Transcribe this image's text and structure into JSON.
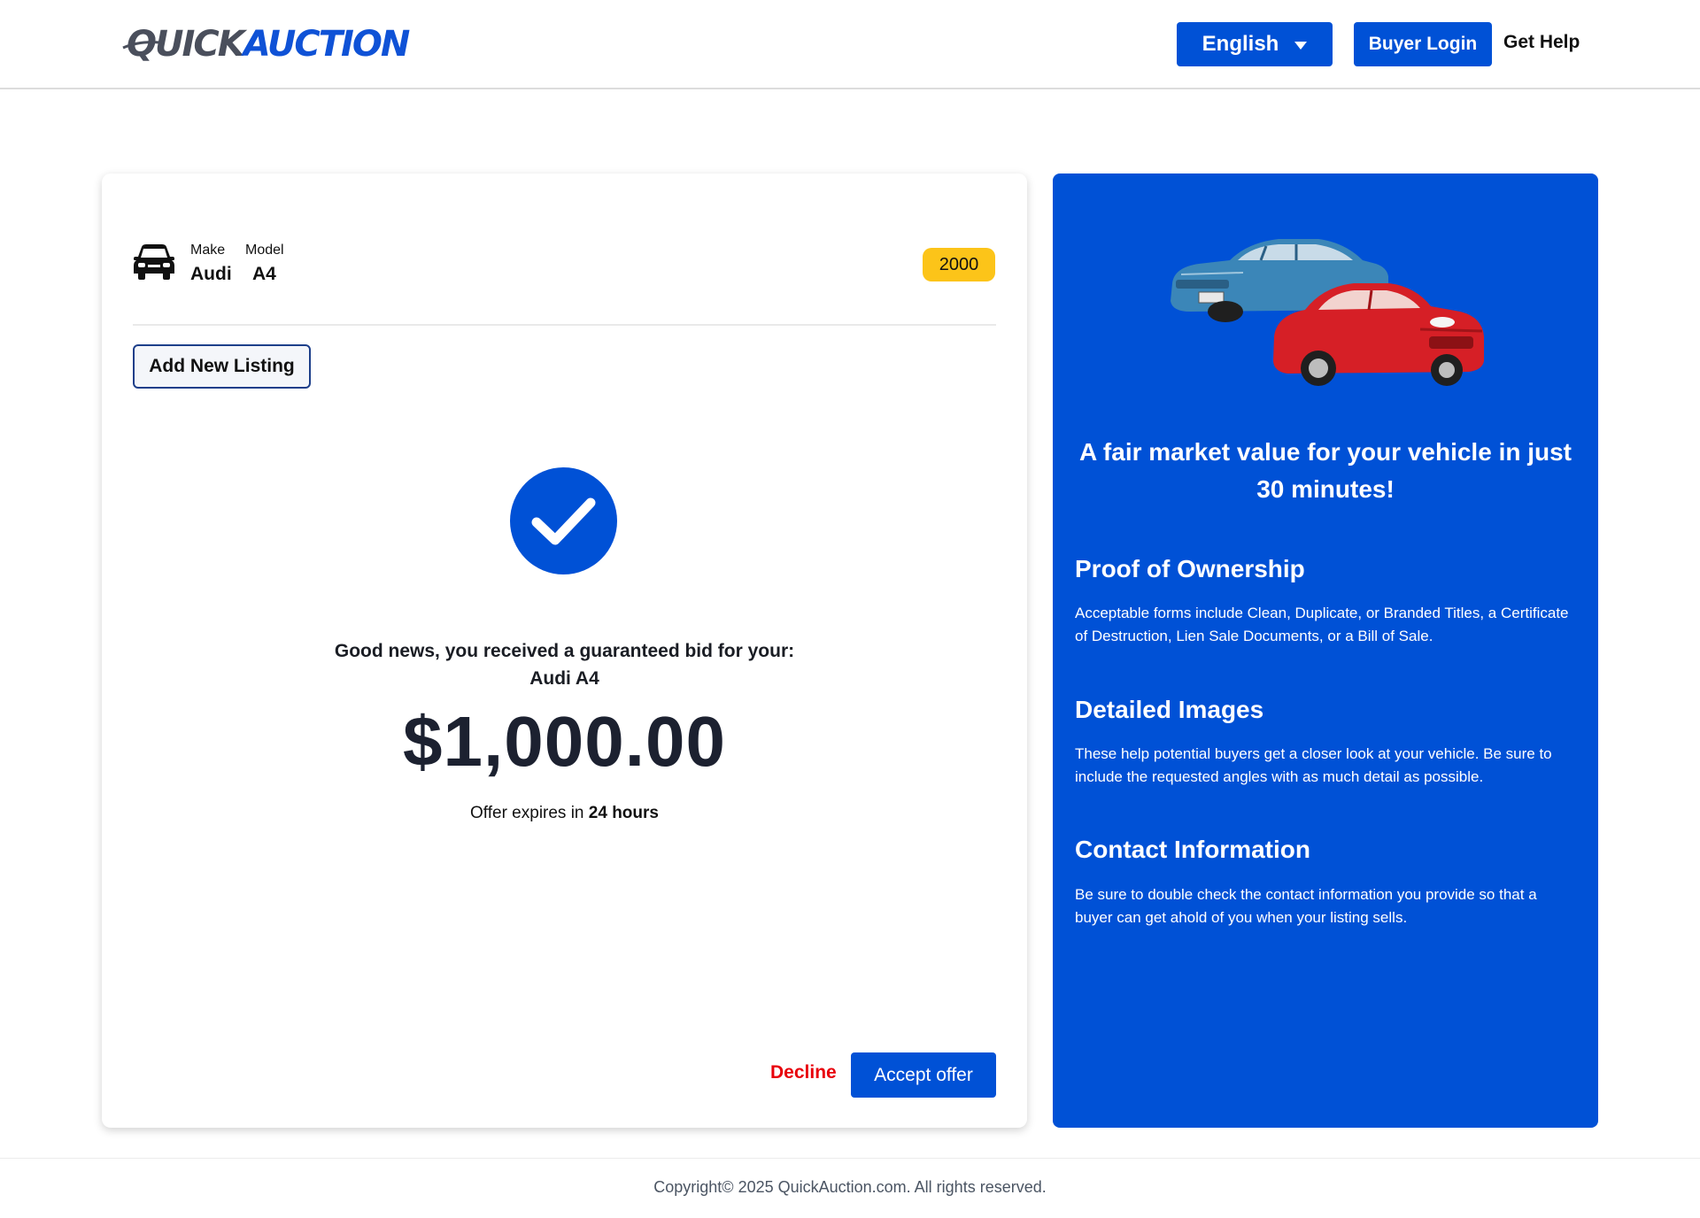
{
  "header": {
    "logo_quick": "QUICK",
    "logo_auction": "AUCTION",
    "language_label": "English",
    "buyer_login_label": "Buyer Login",
    "get_help_label": "Get Help"
  },
  "vehicle": {
    "make_label": "Make",
    "make": "Audi",
    "model_label": "Model",
    "model": "A4",
    "year": "2000"
  },
  "actions": {
    "add_listing_label": "Add New Listing",
    "decline_label": "Decline",
    "accept_label": "Accept offer"
  },
  "offer": {
    "message": "Good news, you received a guaranteed bid for your:",
    "vehicle_name": "Audi A4",
    "amount": "$1,000.00",
    "expires_prefix": "Offer expires in",
    "expires_value": "24 hours"
  },
  "panel": {
    "title": "A fair market value for your vehicle in just 30 minutes!",
    "sections": [
      {
        "heading": "Proof of Ownership",
        "body": "Acceptable forms include Clean, Duplicate, or Branded Titles, a Certificate of Destruction, Lien Sale Documents, or a Bill of Sale."
      },
      {
        "heading": "Detailed Images",
        "body": "These help potential buyers get a closer look at your vehicle. Be sure to include the requested angles with as much detail as possible."
      },
      {
        "heading": "Contact Information",
        "body": "Be sure to double check the contact information you provide so that a buyer can get ahold of you when your listing sells."
      }
    ]
  },
  "footer": {
    "copyright": "Copyright© 2025 QuickAuction.com. All rights reserved."
  },
  "colors": {
    "brand_blue": "#0051d6",
    "year_badge": "#fcc419",
    "decline_red": "#e8000b"
  },
  "icons": [
    "car-icon",
    "checkmark-icon",
    "caret-down-icon",
    "cars-illustration"
  ]
}
